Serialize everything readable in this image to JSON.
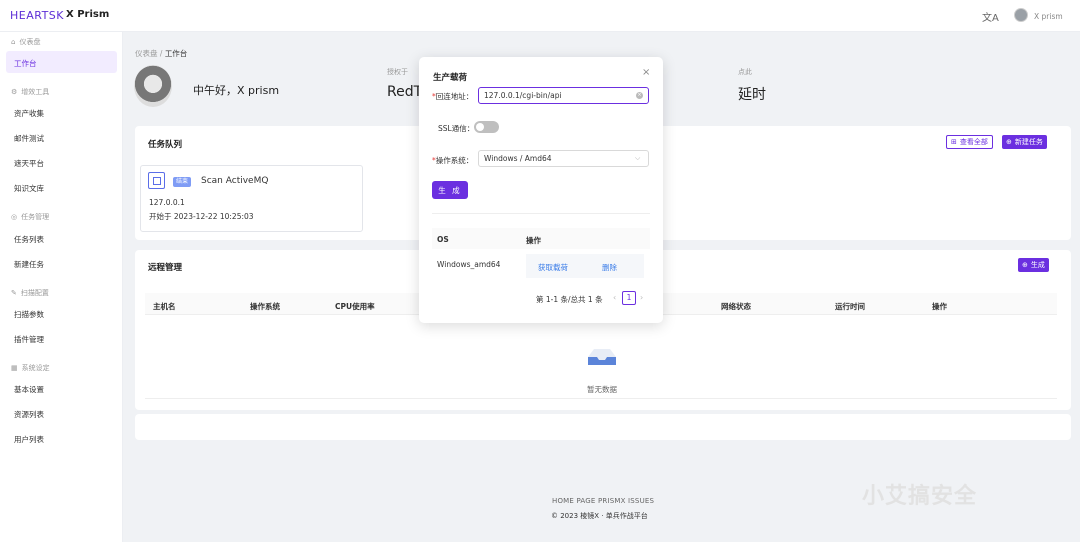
{
  "header": {
    "logo": "HEARTSK",
    "app_title": "X Prism",
    "translate_icon": "translate-icon",
    "user_name": "X prism"
  },
  "sidebar": {
    "groups": [
      {
        "label": "仪表盘",
        "icon": "home-icon",
        "items": [
          "工作台"
        ]
      },
      {
        "label": "增效工具",
        "icon": "gear-icon",
        "items": [
          "资产收集",
          "邮件测试",
          "遮天平台",
          "知识文库"
        ]
      },
      {
        "label": "任务管理",
        "icon": "target-icon",
        "items": [
          "任务列表",
          "新建任务"
        ]
      },
      {
        "label": "扫描配置",
        "icon": "edit-icon",
        "items": [
          "扫描参数",
          "插件管理"
        ]
      },
      {
        "label": "系统设定",
        "icon": "grid-icon",
        "items": [
          "基本设置",
          "资源列表",
          "用户列表"
        ]
      }
    ],
    "active": "工作台"
  },
  "breadcrumb": {
    "root": "仪表盘",
    "sep": "/",
    "current": "工作台"
  },
  "welcome": {
    "greeting": "中午好，X prism",
    "stats": [
      {
        "label": "授权于",
        "value": "RedTe"
      },
      {
        "label": "点此",
        "value": "延时"
      }
    ]
  },
  "task_queue": {
    "title": "任务队列",
    "view_all": "查看全部",
    "new_task": "新建任务",
    "tasks": [
      {
        "badge": "结束",
        "name": "Scan ActiveMQ",
        "host": "127.0.0.1",
        "started": "开始于 2023-12-22 10:25:03"
      }
    ]
  },
  "remote": {
    "title": "远程管理",
    "generate": "生成",
    "columns": [
      "主机名",
      "操作系统",
      "CPU使用率",
      "网络状态",
      "运行时间",
      "操作"
    ],
    "empty_text": "暂无数据"
  },
  "footer": {
    "links": "HOME PAGE  PRISMX ISSUES",
    "copyright": "© 2023 棱镜X · 单兵作战平台"
  },
  "watermark": "小艾搞安全",
  "modal": {
    "title": "生产载荷",
    "close": "×",
    "callback_label": "回连地址：",
    "callback_value": "127.0.0.1/cgi-bin/api",
    "ssl_label": "SSL通信：",
    "ssl_on": false,
    "os_label": "操作系统：",
    "os_value": "Windows / Amd64",
    "generate_button": "生 成",
    "table": {
      "columns": [
        "OS",
        "操作"
      ],
      "rows": [
        {
          "os": "Windows_amd64",
          "actions": [
            "获取载荷",
            "删除"
          ]
        }
      ]
    },
    "pagination": {
      "summary": "第 1-1 条/总共 1 条",
      "current": "1"
    }
  },
  "colors": {
    "accent": "#6b2fe0",
    "link": "#3a7ce8"
  }
}
